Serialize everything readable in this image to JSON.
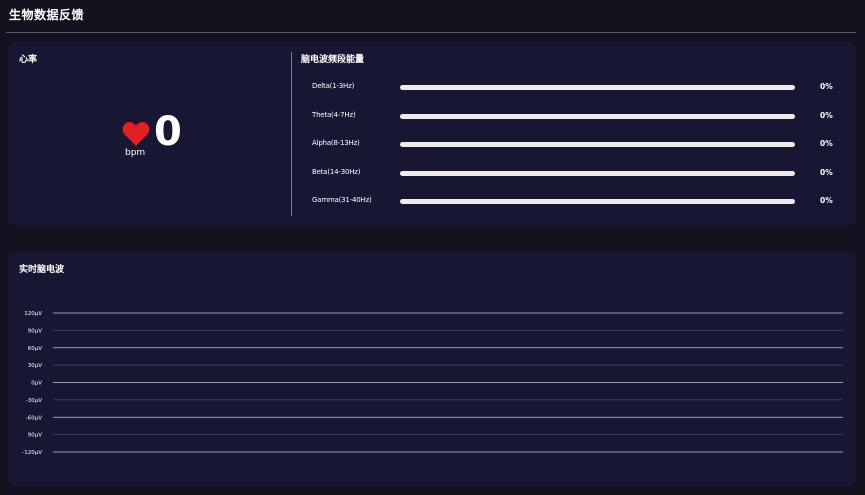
{
  "header": {
    "title": "生物数据反馈"
  },
  "heart_rate": {
    "title": "心率",
    "value": "0",
    "unit": "bpm",
    "icon": "heart-icon",
    "icon_color": "#e02020"
  },
  "bands": {
    "title": "脑电波频段能量",
    "items": [
      {
        "label": "Delta(1-3Hz)",
        "percent_text": "0%",
        "value": 0
      },
      {
        "label": "Theta(4-7Hz)",
        "percent_text": "0%",
        "value": 0
      },
      {
        "label": "Alpha(8-13Hz)",
        "percent_text": "0%",
        "value": 0
      },
      {
        "label": "Beta(14-30Hz)",
        "percent_text": "0%",
        "value": 0
      },
      {
        "label": "Gamma(31-40Hz)",
        "percent_text": "0%",
        "value": 0
      }
    ]
  },
  "eeg": {
    "title": "实时脑电波",
    "chart_data": {
      "type": "line",
      "title": "实时脑电波",
      "ylim": [
        -120,
        120
      ],
      "y_ticks": [
        {
          "value": 120,
          "label": "120μV"
        },
        {
          "value": 90,
          "label": "90μV"
        },
        {
          "value": 60,
          "label": "60μV"
        },
        {
          "value": 30,
          "label": "30μV"
        },
        {
          "value": 0,
          "label": "0μV"
        },
        {
          "value": -30,
          "label": "-30μV"
        },
        {
          "value": -60,
          "label": "-60μV"
        },
        {
          "value": -90,
          "label": "90μV"
        },
        {
          "value": -120,
          "label": "-120μV"
        }
      ],
      "series": [],
      "grid": true
    }
  },
  "colors": {
    "background": "#13131f",
    "card": "#171733",
    "bar_track": "#ececec",
    "bar_fill": "#e93a3a",
    "grid_major": "#c8c8d0",
    "grid_minor": "#4a4a66"
  }
}
